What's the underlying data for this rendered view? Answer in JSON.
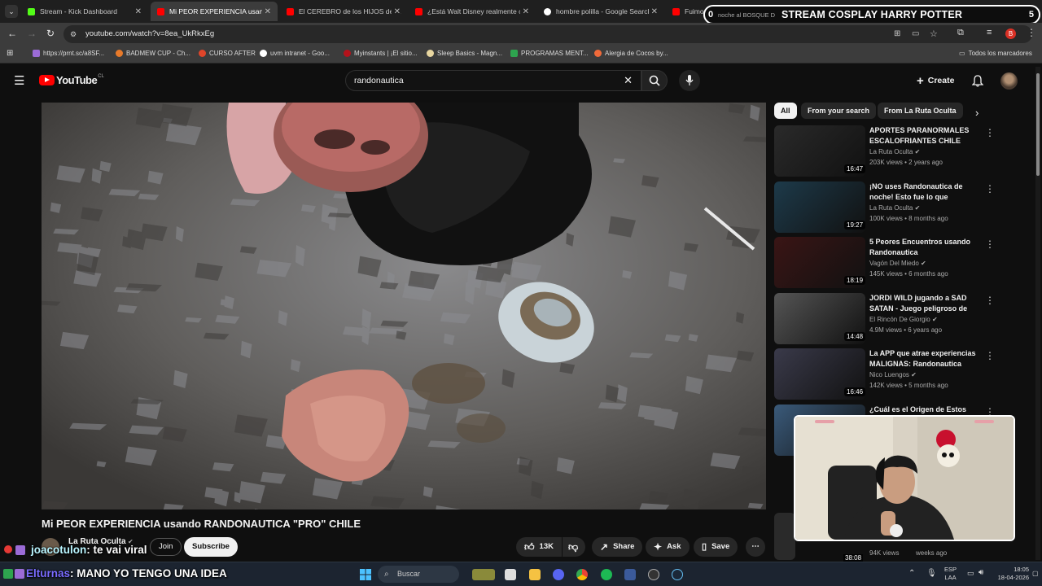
{
  "browser": {
    "tabs": [
      {
        "title": "Stream - Kick Dashboard",
        "color": "#53fc18"
      },
      {
        "title": "Mi PEOR EXPERIENCIA usando",
        "color": "#ff0000"
      },
      {
        "title": "El CEREBRO de los HIJOS de la",
        "color": "#ff0000"
      },
      {
        "title": "¿Está Walt Disney realmente co",
        "color": "#ff0000"
      },
      {
        "title": "hombre polilla - Google Search",
        "color": "#ffffff"
      },
      {
        "title": "Fuimos",
        "color": "#ff0000"
      }
    ],
    "url": "youtube.com/watch?v=8ea_UkRkxEg",
    "bookmarks": [
      "https://prnt.sc/a8SF...",
      "BADMEW CUP - Ch...",
      "CURSO AFTER",
      "uvm intranet - Goo...",
      "Myinstants | ¡El sitio...",
      "Sleep Basics - Magn...",
      "PROGRAMAS MENT...",
      "Alergia de Cocos by..."
    ],
    "all_bookmarks": "Todos los marcadores",
    "profile_letter": "B"
  },
  "stream_overlay": {
    "left_count": "0",
    "ticker": "noche al BOSQUE D",
    "title": "STREAM COSPLAY HARRY POTTER",
    "right_count": "5"
  },
  "youtube": {
    "logo": "YouTube",
    "country": "CL",
    "search_value": "randonautica",
    "create_label": "Create",
    "video": {
      "title": "Mi PEOR EXPERIENCIA usando RANDONAUTICA \"PRO\" CHILE",
      "channel": "La Ruta Oculta",
      "join": "Join",
      "subscribe": "Subscribe",
      "likes": "13K",
      "share": "Share",
      "ask": "Ask",
      "save": "Save"
    },
    "chips": [
      "All",
      "From your search",
      "From La Ruta Oculta"
    ],
    "recommendations": [
      {
        "title": "APORTES PARANORMALES ESCALOFRIANTES CHILE",
        "channel": "La Ruta Oculta",
        "views": "203K views",
        "age": "2 years ago",
        "duration": "16:47",
        "thumb": "#2a2a2a"
      },
      {
        "title": "¡NO uses Randonautica de noche! Esto fue lo que encontr...",
        "channel": "La Ruta Oculta",
        "views": "100K views",
        "age": "8 months ago",
        "duration": "19:27",
        "thumb": "#1d3a4a"
      },
      {
        "title": "5 Peores Encuentros usando Randonautica",
        "channel": "Vagón Del Miedo",
        "views": "145K views",
        "age": "6 months ago",
        "duration": "18:19",
        "thumb": "#3a1515"
      },
      {
        "title": "JORDI WILD jugando a SAD SATAN - Juego peligroso de la...",
        "channel": "El Rincón De Giorgio",
        "views": "4.9M views",
        "age": "6 years ago",
        "duration": "14:48",
        "thumb": "#555555"
      },
      {
        "title": "La APP que atrae experiencias MALIGNAS: Randonautica",
        "channel": "Nico Luengos",
        "views": "142K views",
        "age": "5 months ago",
        "duration": "16:46",
        "thumb": "#3a3a4a"
      },
      {
        "title": "¿Cuál es el Origen de Estos",
        "channel": "",
        "views": "",
        "age": "",
        "duration": "",
        "thumb": "#3a5a7a"
      }
    ],
    "partial_meta": "94K views",
    "partial_age": "weeks ago",
    "partial_duration": "38:08"
  },
  "chat": [
    {
      "user": "joacotulon",
      "message": ": te vai viral"
    },
    {
      "user": "Elturnas",
      "message": ": MANO YO TENGO UNA IDEA"
    }
  ],
  "taskbar": {
    "search": "Buscar",
    "lang": "ESP",
    "layout": "LAA",
    "time": "18:05",
    "date": "18-04-2026"
  }
}
